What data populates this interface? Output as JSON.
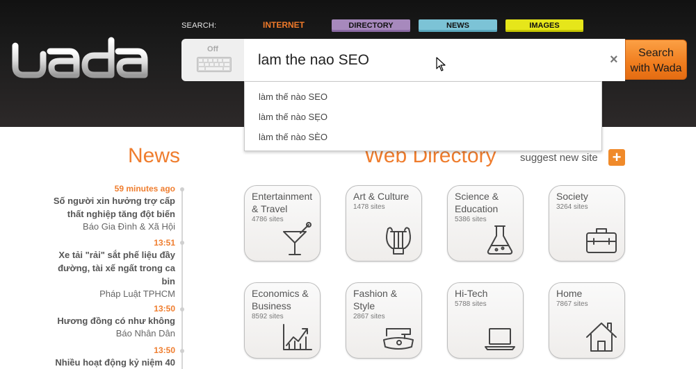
{
  "header": {
    "logo": "wada",
    "search_label": "SEARCH:",
    "tabs": [
      {
        "label": "INTERNET",
        "color": "#f07a2a"
      },
      {
        "label": "DIRECTORY",
        "color": "#a789bd"
      },
      {
        "label": "NEWS",
        "color": "#7cc3d6"
      },
      {
        "label": "IMAGES",
        "color": "#e6e61a"
      }
    ],
    "keyboard_toggle": "Off",
    "search_value": "lam the nao SEO",
    "search_button": [
      "Search",
      "with Wada"
    ],
    "clear_icon": "×"
  },
  "suggestions": [
    "làm thế nào SEO",
    "làm thế nào SẸO",
    "làm thế nào SÈO"
  ],
  "news": {
    "title": "News",
    "items": [
      {
        "time": "59 minutes ago",
        "headline_lines": [
          "Số người xin hưởng trợ cấp",
          "thất nghiệp tăng đột biến"
        ],
        "source": "Báo Gia Đình & Xã Hội"
      },
      {
        "time": "13:51",
        "headline_lines": [
          "Xe tải \"rải\" sắt phế liệu đầy",
          "đường, tài xế ngất trong ca",
          "bin"
        ],
        "source": "Pháp Luật TPHCM"
      },
      {
        "time": "13:50",
        "headline_lines": [
          "Hương đồng có như không"
        ],
        "source": "Báo Nhân Dân"
      },
      {
        "time": "13:50",
        "headline_lines": [
          "Nhiều hoạt động kỷ niệm 40"
        ],
        "source": ""
      }
    ]
  },
  "directory": {
    "title": "Web Directory",
    "suggest_label": "suggest new site",
    "plus": "+",
    "categories": [
      {
        "name_lines": [
          "Entertainment",
          "& Travel"
        ],
        "count": "4786 sites",
        "icon": "cocktail-icon"
      },
      {
        "name_lines": [
          "Art & Culture"
        ],
        "count": "1478 sites",
        "icon": "lyre-icon"
      },
      {
        "name_lines": [
          "Science &",
          "Education"
        ],
        "count": "5386 sites",
        "icon": "flask-icon"
      },
      {
        "name_lines": [
          "Society"
        ],
        "count": "3264 sites",
        "icon": "briefcase-icon"
      },
      {
        "name_lines": [
          "Economics &",
          "Business"
        ],
        "count": "8592 sites",
        "icon": "chart-icon"
      },
      {
        "name_lines": [
          "Fashion &",
          "Style"
        ],
        "count": "2867 sites",
        "icon": "sewing-machine-icon"
      },
      {
        "name_lines": [
          "Hi-Tech"
        ],
        "count": "5788 sites",
        "icon": "laptop-icon"
      },
      {
        "name_lines": [
          "Home"
        ],
        "count": "7867 sites",
        "icon": "house-icon"
      }
    ]
  }
}
